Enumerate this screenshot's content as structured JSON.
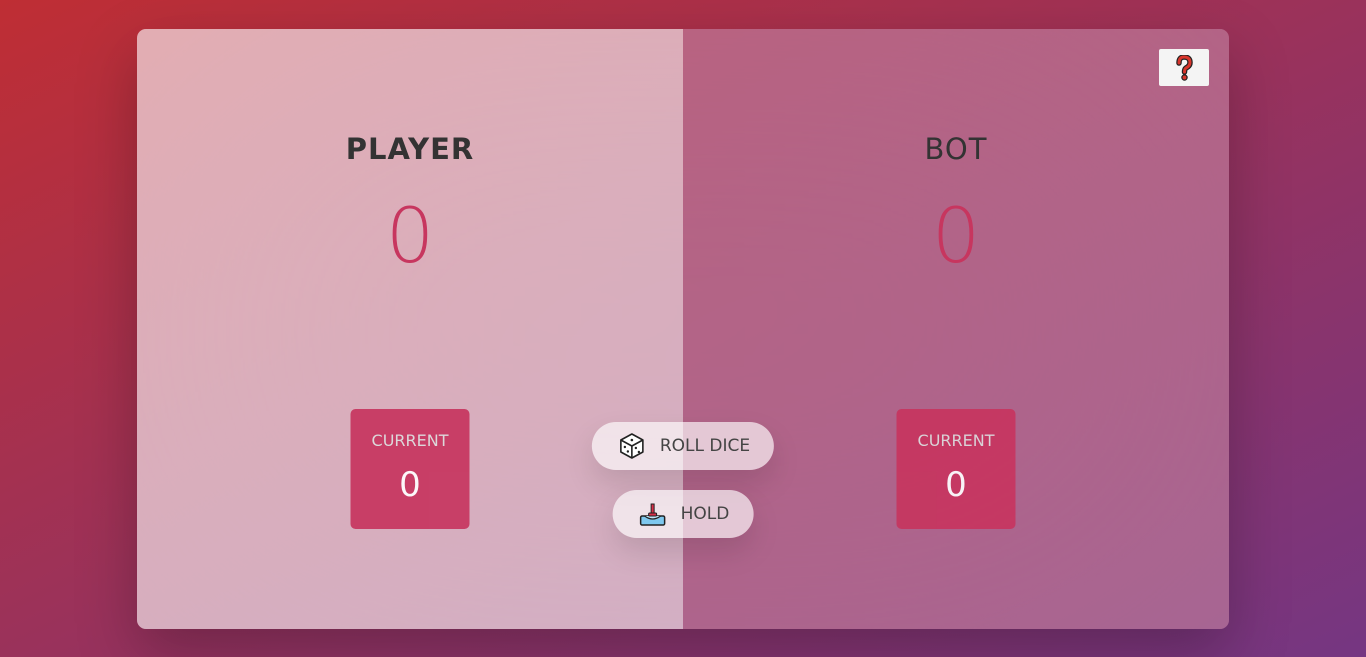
{
  "players": [
    {
      "name": "PLAYER",
      "score": "0",
      "current_label": "CURRENT",
      "current_score": "0",
      "active": true
    },
    {
      "name": "BOT",
      "score": "0",
      "current_label": "CURRENT",
      "current_score": "0",
      "active": false
    }
  ],
  "buttons": {
    "roll": {
      "label": "ROLL DICE",
      "icon": "dice-icon"
    },
    "hold": {
      "label": "HOLD",
      "icon": "hold-icon"
    }
  },
  "help": {
    "icon": "question-mark-icon"
  },
  "colors": {
    "accent": "#c7365f",
    "text": "#333333"
  }
}
